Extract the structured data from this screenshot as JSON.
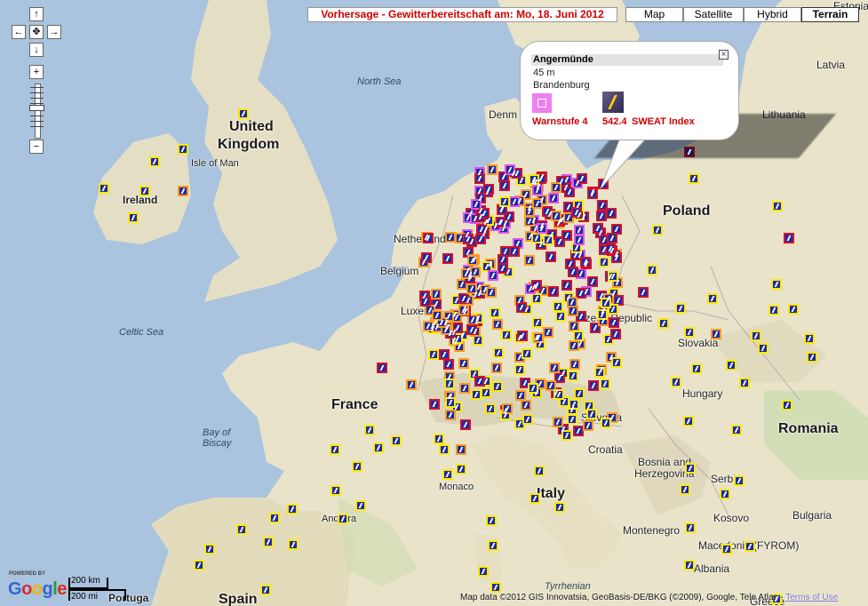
{
  "header": {
    "title": "Vorhersage - Gewitterbereitschaft am: Mo, 18. Juni 2012",
    "map_types": [
      "Map",
      "Satellite",
      "Hybrid",
      "Terrain"
    ],
    "selected_map_type": "Terrain"
  },
  "nav": {
    "up": "↑",
    "left": "←",
    "center": "✥",
    "right": "→",
    "down": "↓",
    "zoom_in": "+",
    "zoom_out": "−"
  },
  "labels": {
    "countries": {
      "uk_1": "United",
      "uk_2": "Kingdom",
      "ireland": "Ireland",
      "france": "France",
      "poland": "Poland",
      "italy": "Italy",
      "romania": "Romania",
      "spain": "Spain",
      "latvia": "Latvia",
      "lithuania": "Lithuania",
      "estonia": "Estonia",
      "denmark": "Denm",
      "netherlands": "Netherlands",
      "belgium": "Belgium",
      "luxembourg": "Luxer",
      "czech": "Czech Republic",
      "slovakia": "Slovakia",
      "hungary": "Hungary",
      "croatia": "Croatia",
      "bosnia_1": "Bosnia and",
      "bosnia_2": "Herzegovina",
      "serbia": "Serbia",
      "kosovo": "Kosovo",
      "montenegro": "Montenegro",
      "bulgaria": "Bulgaria",
      "macedonia": "Macedonia (FYROM)",
      "albania": "Albania",
      "greece": "Greece",
      "monaco": "Monaco",
      "andorra": "Andorra",
      "portugal": "Portuga",
      "slovenia": "Slovenia",
      "isle_of_man": "Isle of Man"
    },
    "seas": {
      "north_sea": "North Sea",
      "celtic_sea": "Celtic Sea",
      "biscay_1": "Bay of",
      "biscay_2": "Biscay",
      "tyrrhenian": "Tyrrhenian"
    }
  },
  "info_window": {
    "place": "Angermünde",
    "elevation": "45 m",
    "region": "Brandenburg",
    "warn_label": "Warnstufe 4",
    "sweat_value": "542.4",
    "sweat_label": "SWEAT Index",
    "close": "×"
  },
  "footer": {
    "powered_by": "POWERED BY",
    "logo": "Google",
    "scale_km": "200 km",
    "scale_mi": "200 mi",
    "copyright": "Map data ©2012 GIS Innovatsia, GeoBasis-DE/BKG (©2009), Google, Tele Atlas - ",
    "terms": "Terms of Use"
  },
  "colors": {
    "warn_yellow": "#ffea00",
    "warn_orange": "#ff9b1c",
    "warn_red": "#d2122a",
    "warn_magenta": "#e055e6",
    "title_red": "#d00000"
  },
  "legend_meaning": {
    "marker_icon": "thunderstorm-warning-icon"
  }
}
